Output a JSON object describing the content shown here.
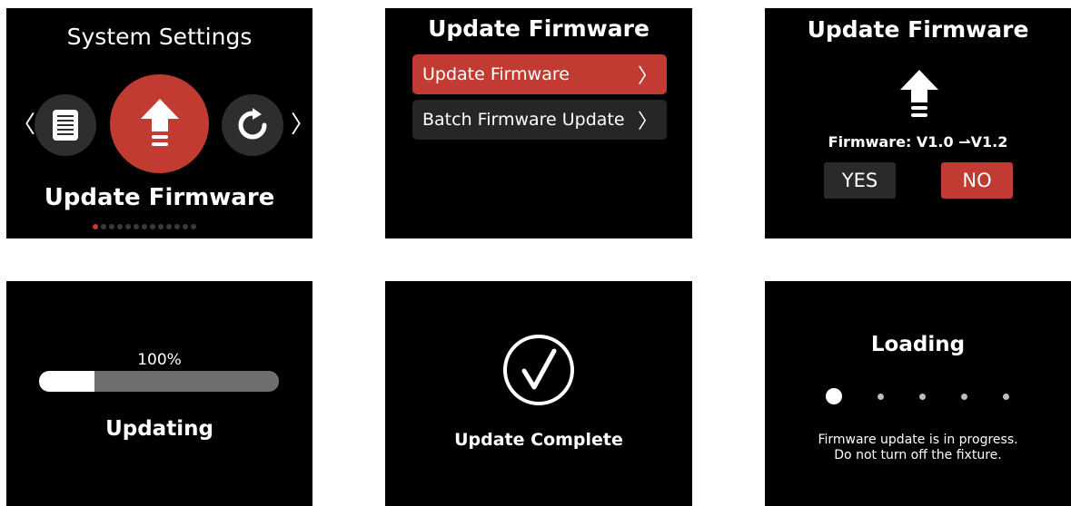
{
  "screen1": {
    "title": "System Settings",
    "prev_chevron": "〈",
    "next_chevron": "〉",
    "menu_items": [
      {
        "icon": "document-icon"
      },
      {
        "icon": "upload-arrow-icon",
        "selected": true
      },
      {
        "icon": "refresh-icon"
      }
    ],
    "selected_label": "Update Firmware",
    "page_indicator": {
      "total": 13,
      "active": 0
    },
    "accent_color": "#c23b32"
  },
  "screen2": {
    "title": "Update Firmware",
    "items": [
      {
        "label": "Update Firmware",
        "chevron": "〉",
        "selected": true
      },
      {
        "label": "Batch Firmware Update",
        "chevron": "〉",
        "selected": false
      }
    ]
  },
  "screen3": {
    "title": "Update Firmware",
    "icon": "upload-arrow-icon",
    "version_text": "Firmware: V1.0 ⇀V1.2",
    "yes_label": "YES",
    "no_label": "NO"
  },
  "screen4": {
    "percent_text": "100%",
    "progress_fraction": 0.23,
    "status": "Updating"
  },
  "screen5": {
    "icon": "checkmark-circle-icon",
    "status": "Update Complete"
  },
  "screen6": {
    "title": "Loading",
    "dots": {
      "count": 5,
      "active": 0
    },
    "message_line1": "Firmware update is in progress.",
    "message_line2": "Do not turn off the fixture."
  }
}
